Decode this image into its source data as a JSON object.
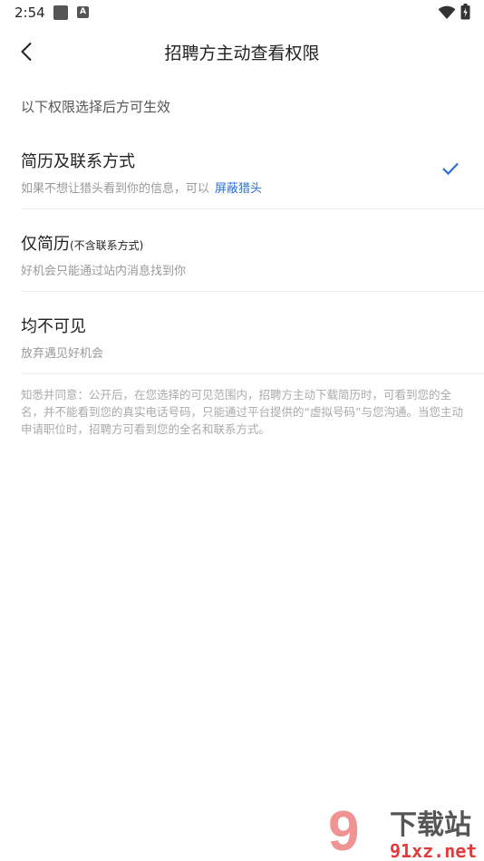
{
  "status": {
    "time": "2:54",
    "a_badge": "A"
  },
  "header": {
    "title": "招聘方主动查看权限"
  },
  "hint": "以下权限选择后方可生效",
  "options": [
    {
      "title": "简历及联系方式",
      "title_note": "",
      "subtitle": "如果不想让猎头看到你的信息，可以",
      "link": "屏蔽猎头",
      "selected": true
    },
    {
      "title": "仅简历",
      "title_note": "(不含联系方式)",
      "subtitle": "好机会只能通过站内消息找到你",
      "link": "",
      "selected": false
    },
    {
      "title": "均不可见",
      "title_note": "",
      "subtitle": "放弃遇见好机会",
      "link": "",
      "selected": false
    }
  ],
  "notice": "知悉并同意：公开后，在您选择的可见范围内，招聘方主动下载简历时，可看到您的全名，并不能看到您的真实电话号码，只能通过平台提供的“虚拟号码”与您沟通。当您主动申请职位时，招聘方可看到您的全名和联系方式。",
  "watermark": {
    "brand": "下载站",
    "domain": "91xz.net",
    "logo_text": "9"
  },
  "colors": {
    "accent": "#2b6fd6",
    "divider": "#ececec",
    "watermark_red": "#e23b3b"
  }
}
